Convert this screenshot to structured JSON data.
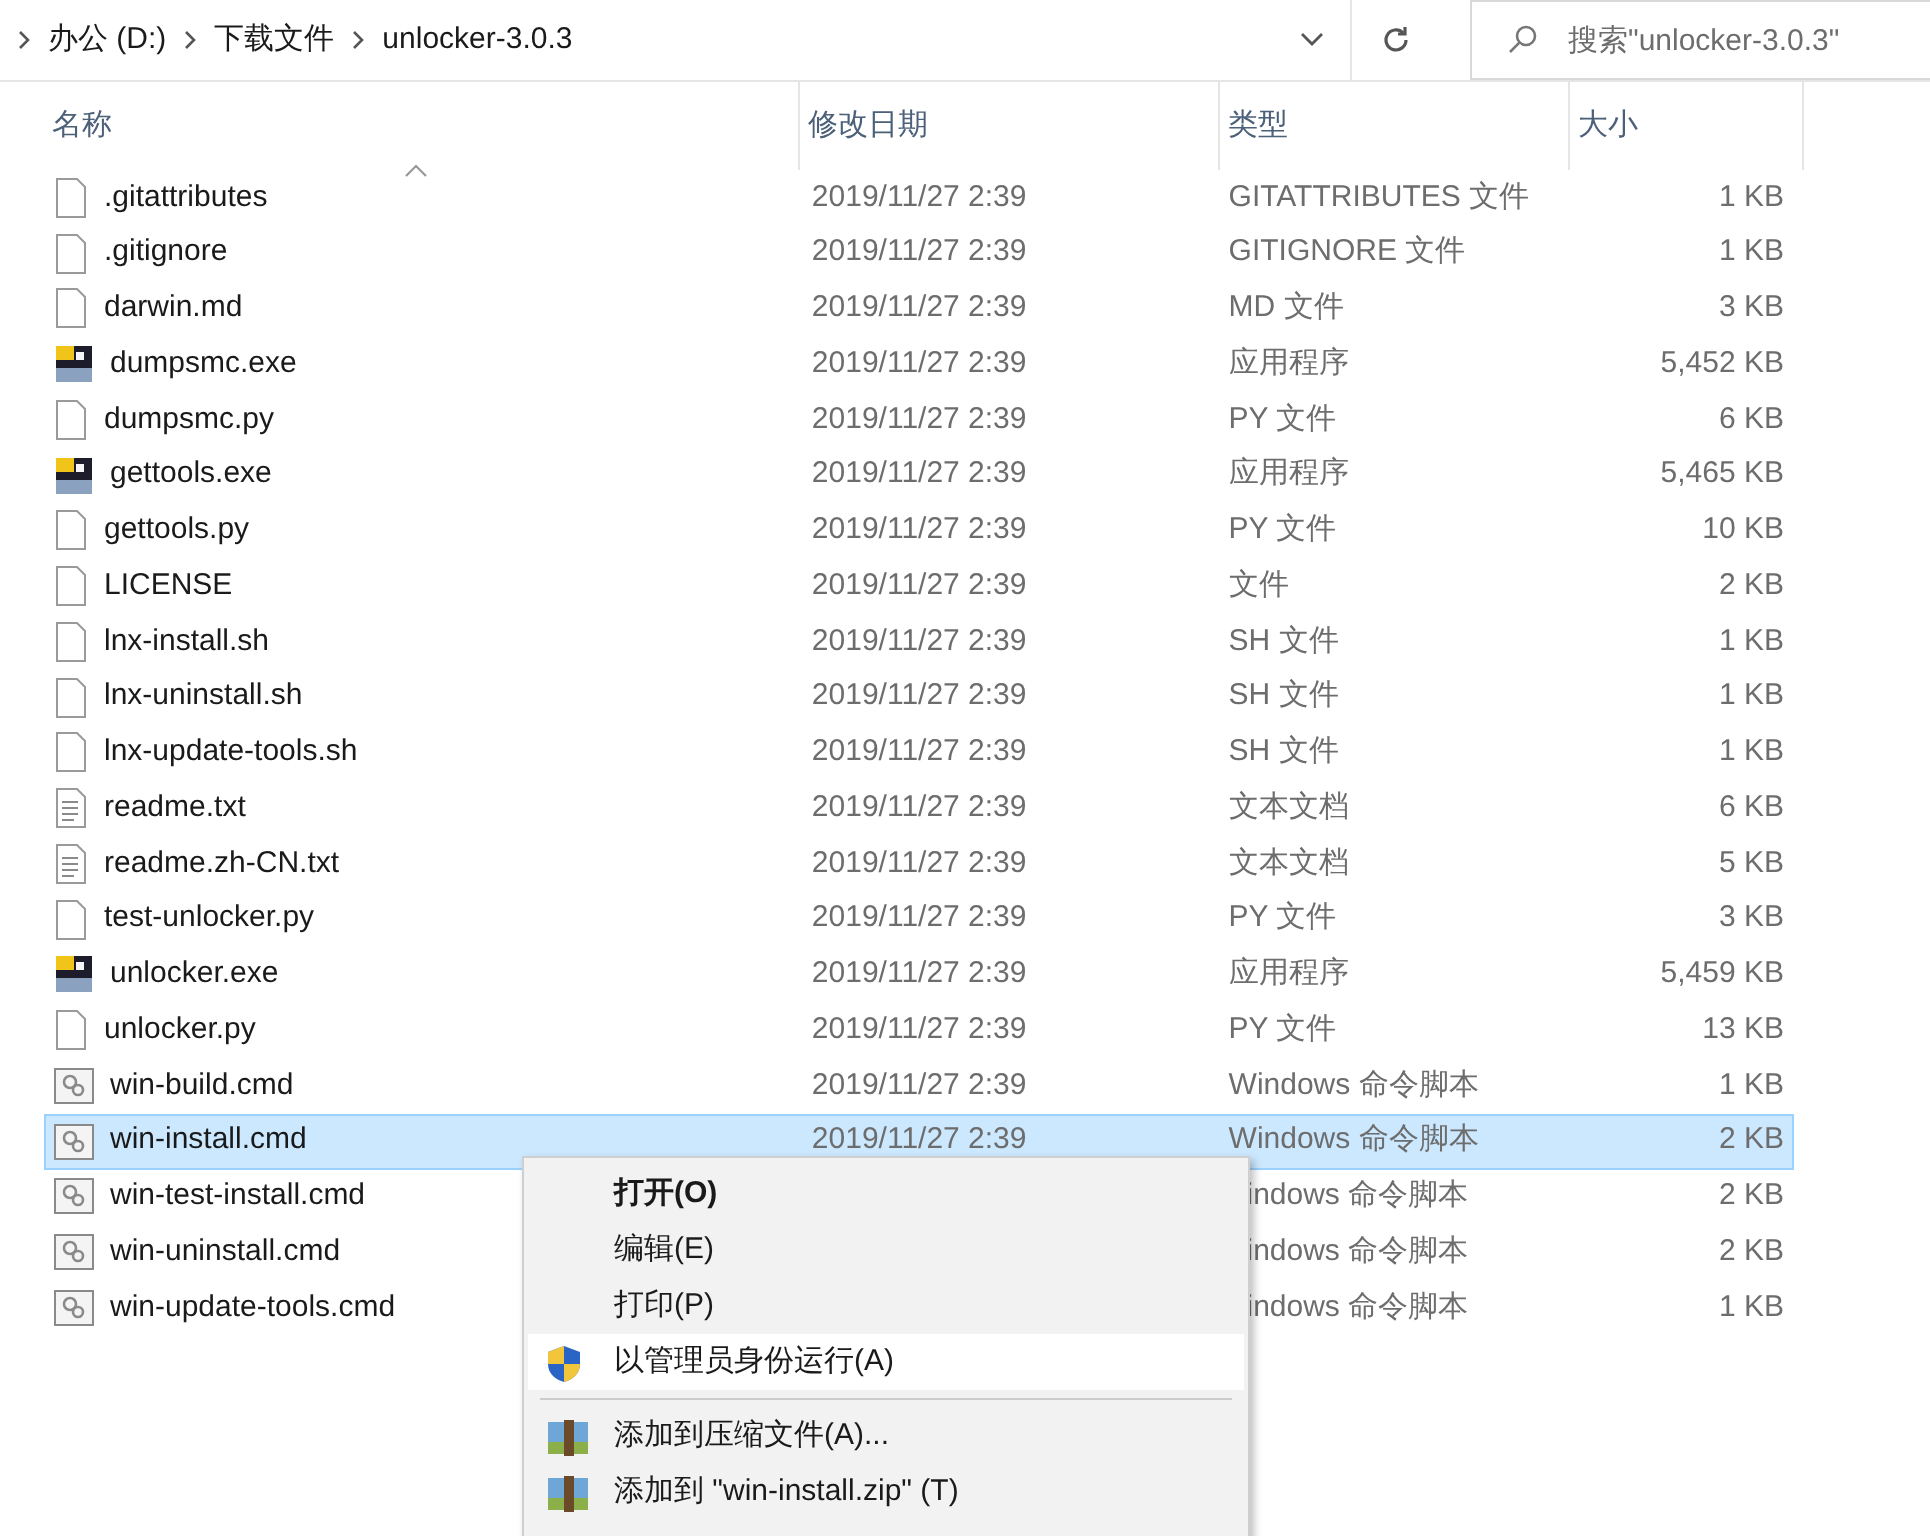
{
  "address_bar": {
    "crumbs": [
      "办公 (D:)",
      "下载文件",
      "unlocker-3.0.3"
    ]
  },
  "search": {
    "placeholder": "搜索\"unlocker-3.0.3\""
  },
  "columns": [
    "名称",
    "修改日期",
    "类型",
    "大小"
  ],
  "files": [
    {
      "name": ".gitattributes",
      "kind": "blank",
      "date": "2019/11/27 2:39",
      "type": "GITATTRIBUTES 文件",
      "size": "1 KB",
      "selected": false
    },
    {
      "name": ".gitignore",
      "kind": "blank",
      "date": "2019/11/27 2:39",
      "type": "GITIGNORE 文件",
      "size": "1 KB",
      "selected": false
    },
    {
      "name": "darwin.md",
      "kind": "blank",
      "date": "2019/11/27 2:39",
      "type": "MD 文件",
      "size": "3 KB",
      "selected": false
    },
    {
      "name": "dumpsmc.exe",
      "kind": "exe",
      "date": "2019/11/27 2:39",
      "type": "应用程序",
      "size": "5,452 KB",
      "selected": false
    },
    {
      "name": "dumpsmc.py",
      "kind": "blank",
      "date": "2019/11/27 2:39",
      "type": "PY 文件",
      "size": "6 KB",
      "selected": false
    },
    {
      "name": "gettools.exe",
      "kind": "exe",
      "date": "2019/11/27 2:39",
      "type": "应用程序",
      "size": "5,465 KB",
      "selected": false
    },
    {
      "name": "gettools.py",
      "kind": "blank",
      "date": "2019/11/27 2:39",
      "type": "PY 文件",
      "size": "10 KB",
      "selected": false
    },
    {
      "name": "LICENSE",
      "kind": "blank",
      "date": "2019/11/27 2:39",
      "type": "文件",
      "size": "2 KB",
      "selected": false
    },
    {
      "name": "lnx-install.sh",
      "kind": "blank",
      "date": "2019/11/27 2:39",
      "type": "SH 文件",
      "size": "1 KB",
      "selected": false
    },
    {
      "name": "lnx-uninstall.sh",
      "kind": "blank",
      "date": "2019/11/27 2:39",
      "type": "SH 文件",
      "size": "1 KB",
      "selected": false
    },
    {
      "name": "lnx-update-tools.sh",
      "kind": "blank",
      "date": "2019/11/27 2:39",
      "type": "SH 文件",
      "size": "1 KB",
      "selected": false
    },
    {
      "name": "readme.txt",
      "kind": "text",
      "date": "2019/11/27 2:39",
      "type": "文本文档",
      "size": "6 KB",
      "selected": false
    },
    {
      "name": "readme.zh-CN.txt",
      "kind": "text",
      "date": "2019/11/27 2:39",
      "type": "文本文档",
      "size": "5 KB",
      "selected": false
    },
    {
      "name": "test-unlocker.py",
      "kind": "blank",
      "date": "2019/11/27 2:39",
      "type": "PY 文件",
      "size": "3 KB",
      "selected": false
    },
    {
      "name": "unlocker.exe",
      "kind": "exe",
      "date": "2019/11/27 2:39",
      "type": "应用程序",
      "size": "5,459 KB",
      "selected": false
    },
    {
      "name": "unlocker.py",
      "kind": "blank",
      "date": "2019/11/27 2:39",
      "type": "PY 文件",
      "size": "13 KB",
      "selected": false
    },
    {
      "name": "win-build.cmd",
      "kind": "cmd",
      "date": "2019/11/27 2:39",
      "type": "Windows 命令脚本",
      "size": "1 KB",
      "selected": false
    },
    {
      "name": "win-install.cmd",
      "kind": "cmd",
      "date": "2019/11/27 2:39",
      "type": "Windows 命令脚本",
      "size": "2 KB",
      "selected": true
    },
    {
      "name": "win-test-install.cmd",
      "kind": "cmd",
      "type": "indows 命令脚本",
      "size": "2 KB",
      "selected": false
    },
    {
      "name": "win-uninstall.cmd",
      "kind": "cmd",
      "type": "indows 命令脚本",
      "size": "2 KB",
      "selected": false
    },
    {
      "name": "win-update-tools.cmd",
      "kind": "cmd",
      "type": "indows 命令脚本",
      "size": "1 KB",
      "selected": false
    }
  ],
  "context_menu": [
    {
      "kind": "default",
      "label": "打开(O)",
      "selected": false
    },
    {
      "kind": "plain",
      "label": "编辑(E)",
      "selected": false
    },
    {
      "kind": "plain",
      "label": "打印(P)",
      "selected": false
    },
    {
      "kind": "admin",
      "label": "以管理员身份运行(A)",
      "selected": true
    },
    {
      "kind": "separator"
    },
    {
      "kind": "archive",
      "label": "添加到压缩文件(A)...",
      "selected": false
    },
    {
      "kind": "archive",
      "label": "添加到 \"win-install.zip\" (T)",
      "selected": false
    }
  ]
}
